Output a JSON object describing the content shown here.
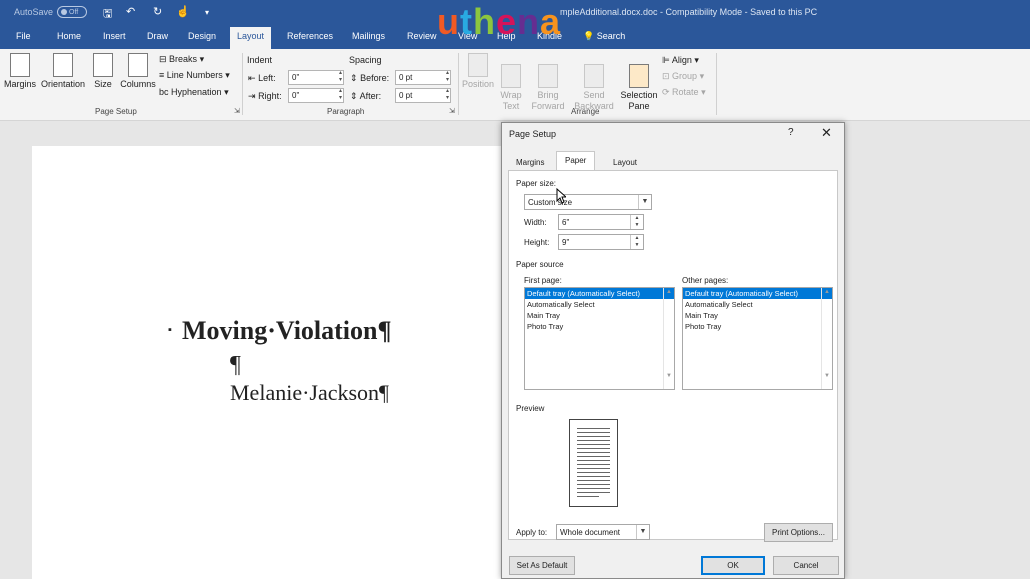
{
  "titlebar": {
    "autosave_label": "AutoSave",
    "autosave_state": "Off",
    "doc_title": "mpleAdditional.docx.doc  -  Compatibility Mode  -  Saved to this PC",
    "logo": [
      "u",
      "t",
      "h",
      "e",
      "n",
      "a"
    ]
  },
  "tabs": [
    "File",
    "Home",
    "Insert",
    "Draw",
    "Design",
    "Layout",
    "References",
    "Mailings",
    "Review",
    "View",
    "Help",
    "Kindle"
  ],
  "active_tab": "Layout",
  "search_label": "Search",
  "ribbon": {
    "margins": "Margins",
    "orientation": "Orientation",
    "size": "Size",
    "columns": "Columns",
    "breaks": "Breaks",
    "line_numbers": "Line Numbers",
    "hyphenation": "Hyphenation",
    "page_setup_group": "Page Setup",
    "indent_heading": "Indent",
    "indent_left_label": "Left:",
    "indent_left_value": "0\"",
    "indent_right_label": "Right:",
    "indent_right_value": "0\"",
    "spacing_heading": "Spacing",
    "before_label": "Before:",
    "before_value": "0 pt",
    "after_label": "After:",
    "after_value": "0 pt",
    "paragraph_group": "Paragraph",
    "position": "Position",
    "wrap_text": "Wrap\nText",
    "bring_forward": "Bring\nForward",
    "send_backward": "Send\nBackward",
    "selection_pane": "Selection\nPane",
    "align": "Align",
    "group": "Group",
    "rotate": "Rotate",
    "arrange_group": "Arrange"
  },
  "document": {
    "title": "Moving·Violation¶",
    "blank": "¶",
    "author": "Melanie·Jackson¶"
  },
  "dialog": {
    "title": "Page Setup",
    "help": "?",
    "close": "✕",
    "tabs": [
      "Margins",
      "Paper",
      "Layout"
    ],
    "active_tab": "Paper",
    "paper_size_label": "Paper size:",
    "paper_size_value": "Custom size",
    "width_label": "Width:",
    "width_value": "6\"",
    "height_label": "Height:",
    "height_value": "9\"",
    "paper_source_label": "Paper source",
    "first_page_label": "First page:",
    "other_pages_label": "Other pages:",
    "tray_options": [
      "Default tray (Automatically Select)",
      "Automatically Select",
      "Main Tray",
      "Photo Tray"
    ],
    "preview_label": "Preview",
    "apply_to_label": "Apply to:",
    "apply_to_value": "Whole document",
    "print_options": "Print Options...",
    "set_as_default": "Set As Default",
    "ok": "OK",
    "cancel": "Cancel"
  },
  "colors": {
    "word_blue": "#2b579a",
    "selection_blue": "#0078d7"
  }
}
